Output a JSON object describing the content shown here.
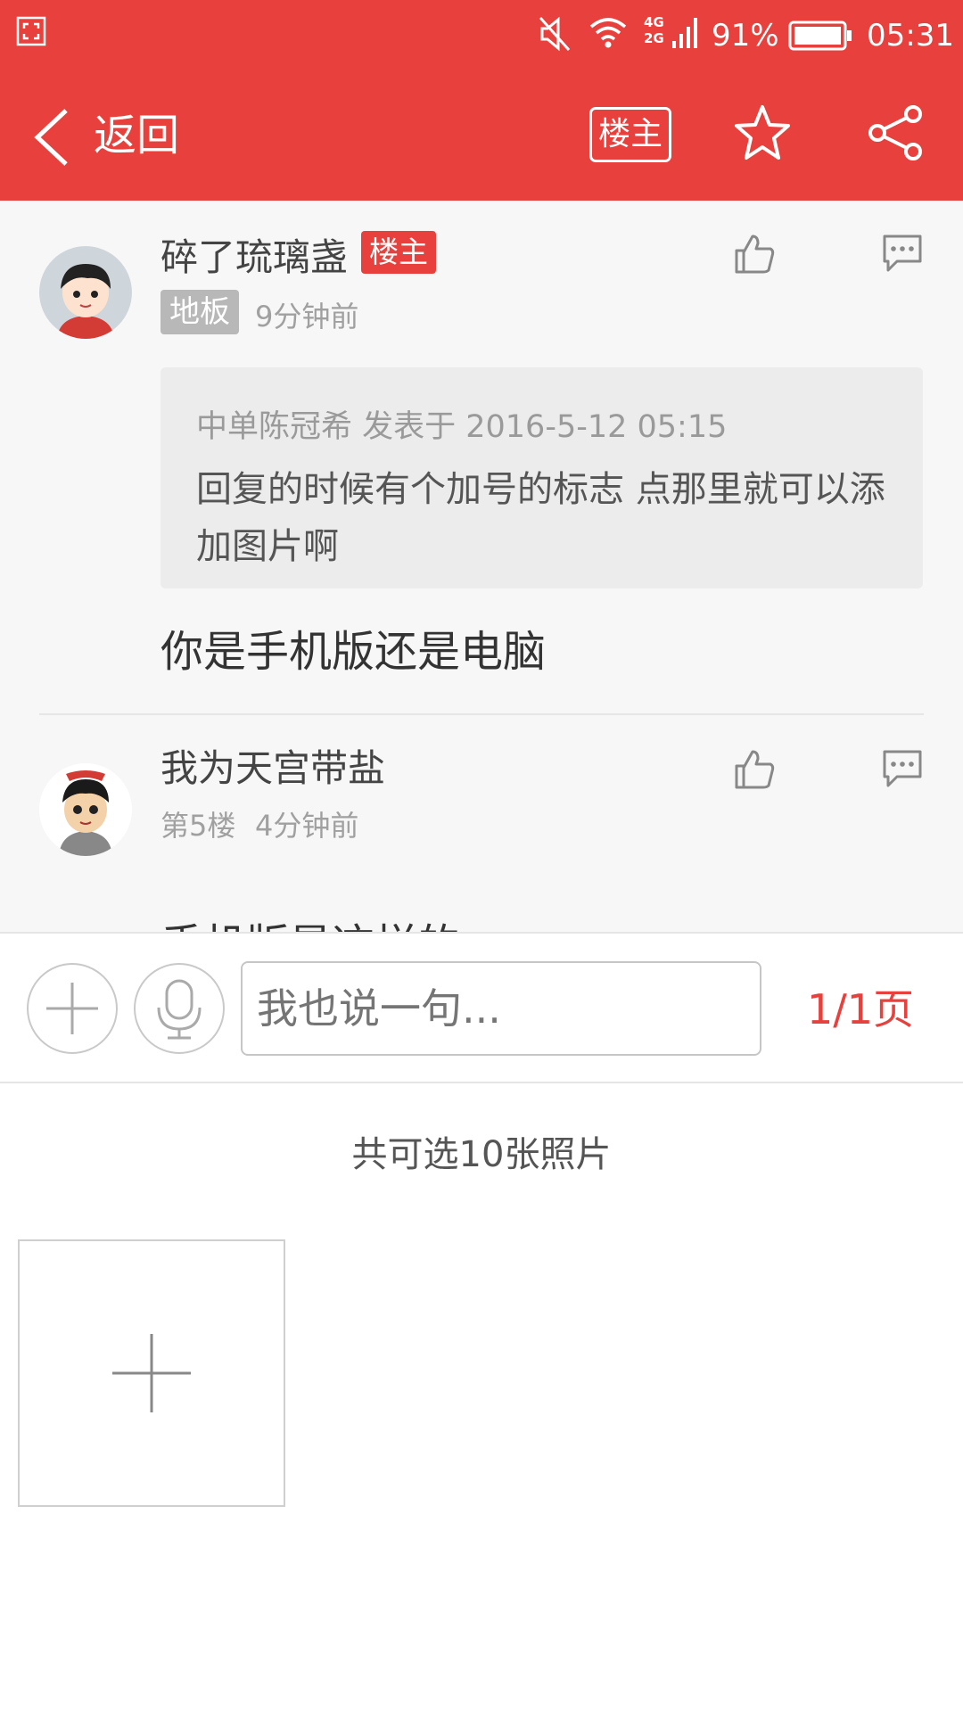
{
  "status_bar": {
    "signal_label": "4G\n2G",
    "battery": "91%",
    "time": "05:31"
  },
  "header": {
    "back_label": "返回",
    "op_button": "楼主",
    "icons": [
      "chevron-left-icon",
      "star-icon",
      "share-icon"
    ]
  },
  "posts": [
    {
      "username": "碎了琉璃盏",
      "badge": "楼主",
      "floor": "地板",
      "time": "9分钟前",
      "quote": {
        "header": "中单陈冠希 发表于 2016-5-12 05:15",
        "body": "回复的时候有个加号的标志 点那里就可以添加图片啊"
      },
      "text": "你是手机版还是电脑"
    },
    {
      "username": "我为天宫带盐",
      "floor": "第5楼",
      "time": "4分钟前",
      "text": "手机版是这样的"
    }
  ],
  "input_bar": {
    "placeholder": "我也说一句...",
    "page_indicator": "1/1页"
  },
  "photo_picker": {
    "title": "共可选10张照片"
  },
  "colors": {
    "accent": "#e8403c",
    "content_bg": "#f7f7f7"
  }
}
